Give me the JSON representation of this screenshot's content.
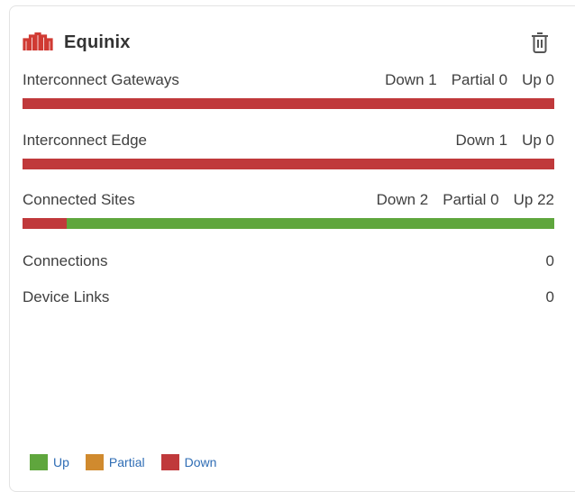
{
  "brand": {
    "name": "Equinix",
    "logo_icon": "equinix-logo-icon",
    "logo_color": "#d03a33"
  },
  "actions": {
    "delete_icon": "trash-icon"
  },
  "colors": {
    "up": "#5fa63d",
    "partial": "#d08a2e",
    "down": "#c0393b"
  },
  "interconnect_gateways": {
    "label": "Interconnect Gateways",
    "down": "Down 1",
    "partial": "Partial 0",
    "up": "Up 0",
    "down_fraction": 1.0,
    "partial_fraction": 0.0,
    "up_fraction": 0.0
  },
  "interconnect_edge": {
    "label": "Interconnect Edge",
    "down": "Down 1",
    "up": "Up 0",
    "down_fraction": 1.0,
    "up_fraction": 0.0
  },
  "connected_sites": {
    "label": "Connected Sites",
    "down": "Down 2",
    "partial": "Partial 0",
    "up": "Up 22",
    "down_fraction": 0.0833,
    "partial_fraction": 0.0,
    "up_fraction": 0.9167
  },
  "connections": {
    "label": "Connections",
    "value": "0"
  },
  "device_links": {
    "label": "Device Links",
    "value": "0"
  },
  "legend": {
    "up": "Up",
    "partial": "Partial",
    "down": "Down"
  }
}
